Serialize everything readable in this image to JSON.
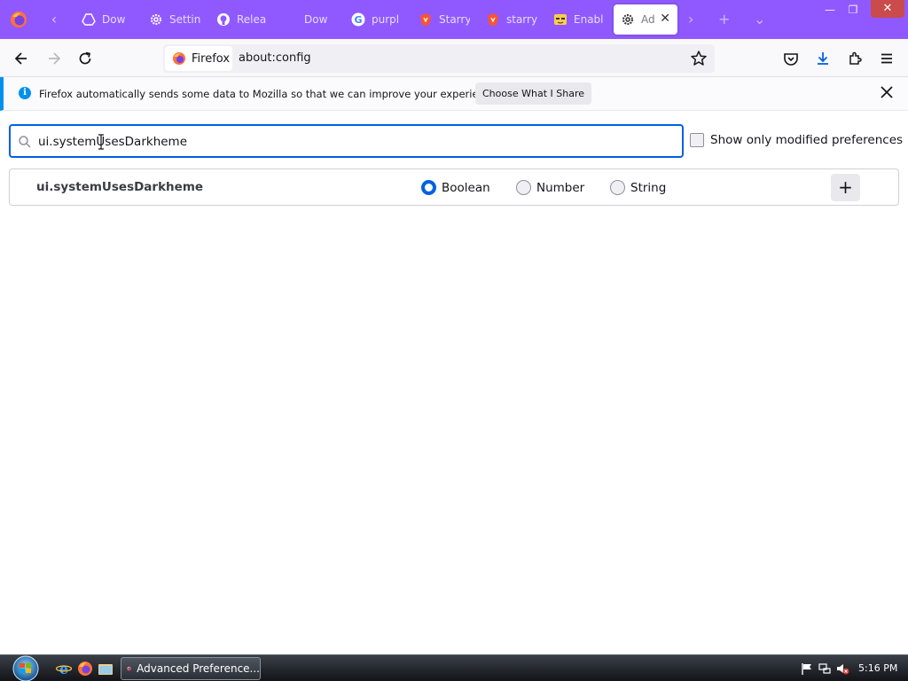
{
  "tabs": [
    {
      "label": "Dow",
      "icon": "drive-icon"
    },
    {
      "label": "Settin",
      "icon": "gear-icon"
    },
    {
      "label": "Relea",
      "icon": "github-icon"
    },
    {
      "label": "Dow",
      "icon": "download-icon"
    },
    {
      "label": "purpl",
      "icon": "google-icon"
    },
    {
      "label": "Starry",
      "icon": "brave-icon"
    },
    {
      "label": "starry",
      "icon": "brave-icon"
    },
    {
      "label": "Enabl",
      "icon": "emoji-icon"
    },
    {
      "label": "Ad",
      "icon": "gear-icon",
      "active": true
    }
  ],
  "navbar": {
    "identity_label": "Firefox",
    "url": "about:config"
  },
  "notification": {
    "message": "Firefox automatically sends some data to Mozilla so that we can improve your experience.",
    "button_label": "Choose What I Share"
  },
  "config": {
    "search_value": "ui.systemUsesDarkheme",
    "modified_only_label": "Show only modified preferences",
    "modified_only_checked": false,
    "new_pref": {
      "name": "ui.systemUsesDarkheme",
      "types": [
        "Boolean",
        "Number",
        "String"
      ],
      "selected_type": "Boolean",
      "add_label": "+"
    }
  },
  "taskbar": {
    "task_label": "Advanced Preference...",
    "clock": "5:16 PM"
  },
  "colors": {
    "tabstrip": "#9059ff",
    "accent": "#0061e0",
    "info": "#0090ed"
  }
}
